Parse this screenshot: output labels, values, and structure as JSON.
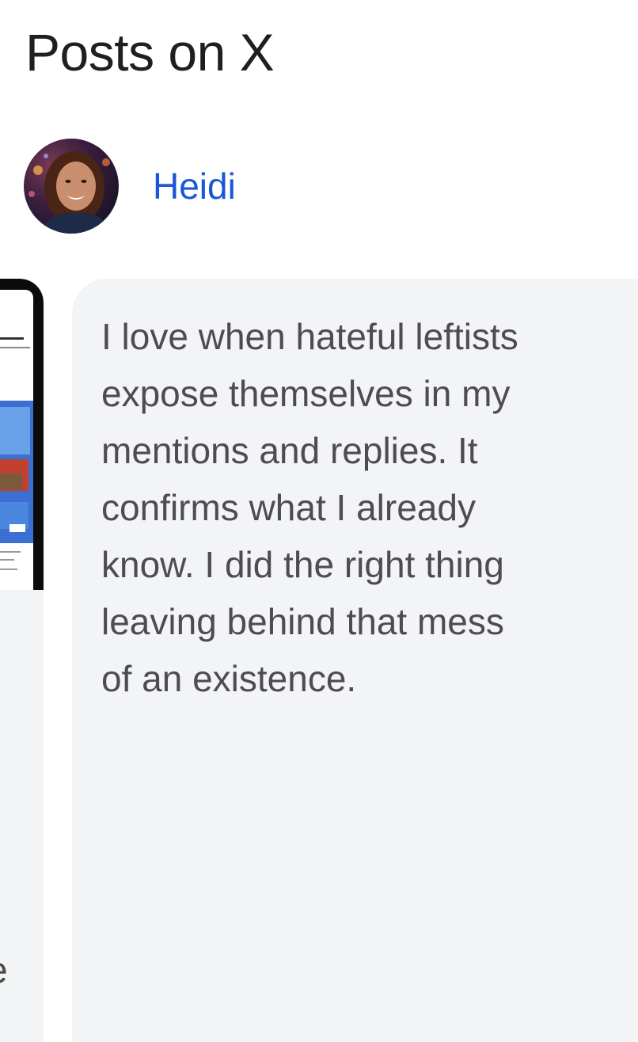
{
  "section": {
    "title": "Posts on X"
  },
  "author": {
    "name": "Heidi",
    "avatar_icon": "profile-photo",
    "link_color": "#1a57d6"
  },
  "carousel": {
    "previous_card": {
      "thumbnail_icon": "phone-screenshot-thumbnail",
      "truncated_text": "e"
    },
    "current_post": {
      "text": "I love when hateful leftists\nexpose themselves in my\nmentions and replies. It\nconfirms what I already\nknow. I did the right thing\nleaving behind that mess\nof an existence."
    },
    "card_background": "#f3f4f6"
  }
}
